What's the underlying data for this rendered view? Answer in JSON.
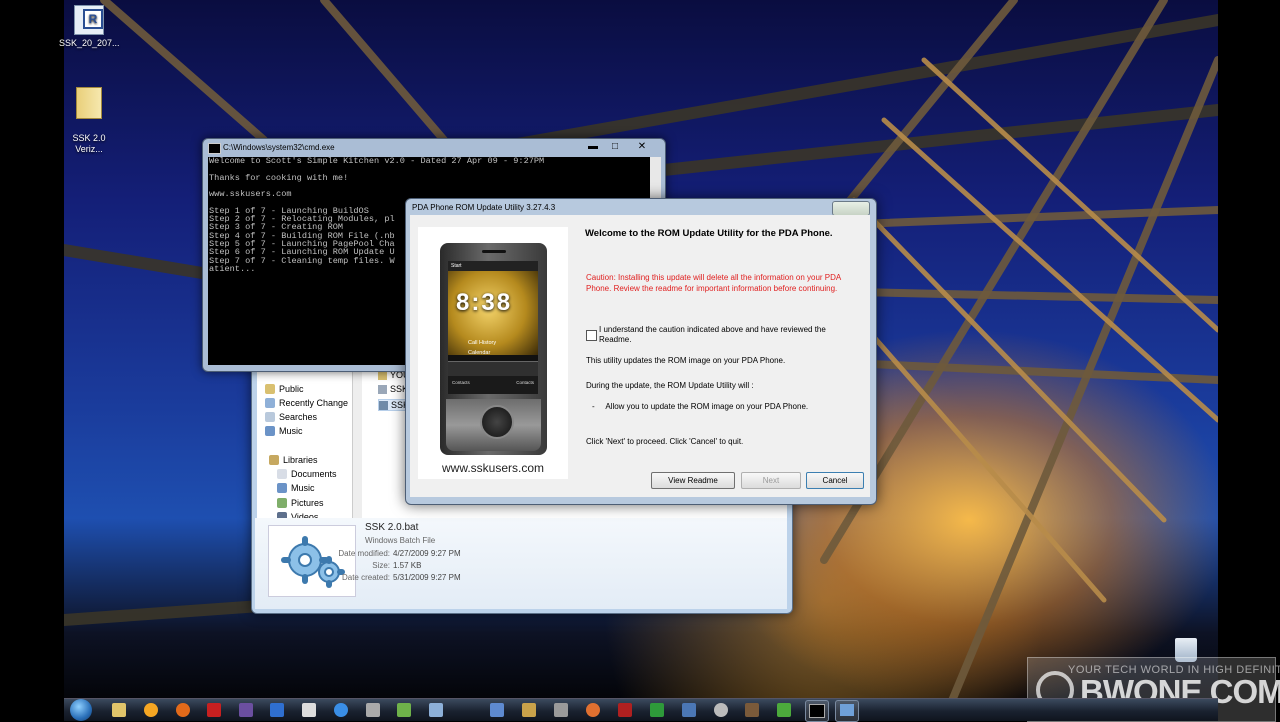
{
  "desktop": {
    "icons": [
      {
        "label": "SSK_20_207...",
        "icon": "app-r-icon"
      },
      {
        "label": "SSK 2.0\nVeriz...",
        "icon": "folder-icon"
      }
    ]
  },
  "cmd_window": {
    "title": "C:\\Windows\\system32\\cmd.exe",
    "lines": [
      "Welcome to Scott's Simple Kitchen v2.0 - Dated 27 Apr 09 - 9:27PM",
      "",
      "Thanks for cooking with me!",
      "",
      "www.sskusers.com",
      "",
      "Step 1 of 7 - Launching BuildOS",
      "Step 2 of 7 - Relocating Modules, pl",
      "Step 3 of 7 - Creating ROM",
      "Step 4 of 7 - Building ROM File (.nb",
      "Step 5 of 7 - Launching PagePool Cha",
      "Step 6 of 7 - Launching ROM Update U",
      "Step 7 of 7 - Cleaning temp files. W",
      "atient..."
    ],
    "buttons": {
      "minimize": "▬",
      "maximize": "□",
      "close": "✕"
    }
  },
  "explorer": {
    "nav": [
      "Public",
      "Recently Change",
      "Searches",
      "Music",
      "Libraries",
      "Documents",
      "Music",
      "Pictures",
      "Videos"
    ],
    "files": [
      "YOU",
      "SSK",
      "SSK"
    ],
    "details": {
      "name": "SSK 2.0.bat",
      "type": "Windows Batch File",
      "date_modified_label": "Date modified:",
      "date_modified": "4/27/2009 9:27 PM",
      "size_label": "Size:",
      "size": "1.57 KB",
      "date_created_label": "Date created:",
      "date_created": "5/31/2009 9:27 PM"
    }
  },
  "rom_dialog": {
    "title": "PDA Phone ROM Update Utility 3.27.4.3",
    "heading": "Welcome to the ROM Update Utility for the PDA Phone.",
    "caution": "Caution: Installing this update will delete all the information on your PDA Phone. Review the readme for important information before continuing.",
    "checkbox_label": "I understand the caution indicated above and have reviewed the Readme.",
    "checkbox_checked": false,
    "line1": "This utility updates the ROM image on your PDA Phone.",
    "line2": "During the update, the ROM Update Utility will :",
    "bullet": "-     Allow you to update the ROM image on your PDA Phone.",
    "line3": "Click 'Next' to proceed. Click 'Cancel' to quit.",
    "url": "www.sskusers.com",
    "phone": {
      "clock": "8:38",
      "menu1": "Call History",
      "menu2": "Calendar",
      "soft_left": "Contacts",
      "soft_right": "Contacts",
      "start": "Start"
    },
    "buttons": {
      "view_readme": "View Readme",
      "next": "Next",
      "cancel": "Cancel"
    }
  },
  "watermark": {
    "tagline": "YOUR TECH WORLD IN HIGH DEFINITION",
    "brand": "BWONE.COM"
  }
}
